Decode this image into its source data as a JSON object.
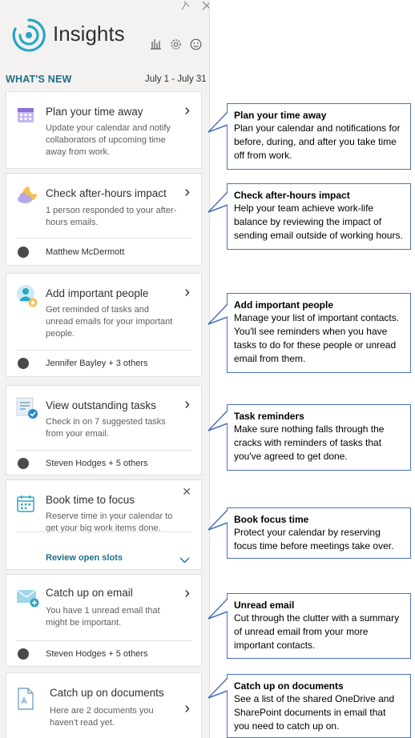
{
  "header": {
    "title": "Insights",
    "whats_new": "WHAT'S NEW",
    "date_range": "July 1 - July 31"
  },
  "cards": [
    {
      "title": "Plan your time away",
      "desc": "Update your calendar and notify collaborators of upcoming time away from work.",
      "icon": "calendar-icon"
    },
    {
      "title": "Check after-hours impact",
      "desc": "1 person responded to your after-hours emails.",
      "people": "Matthew McDermott",
      "icon": "moon-cloud-icon"
    },
    {
      "title": "Add important people",
      "desc": "Get reminded of tasks and unread emails for your important people.",
      "people": "Jennifer Bayley + 3 others",
      "icon": "person-star-icon"
    },
    {
      "title": "View outstanding tasks",
      "desc": "Check in on 7 suggested tasks from your email.",
      "people": "Steven Hodges + 5 others",
      "icon": "task-check-icon"
    },
    {
      "title": "Book time to focus",
      "desc": "Reserve time in your calendar to get your big work items done.",
      "action": "Review open slots",
      "icon": "calendar-focus-icon"
    },
    {
      "title": "Catch up on email",
      "desc": "You have 1 unread email that might be important.",
      "people": "Steven Hodges + 5 others",
      "icon": "envelope-icon"
    },
    {
      "title": "Catch up on documents",
      "desc": "Here are 2 documents you haven't read yet.",
      "icon": "document-icon"
    }
  ],
  "callouts": [
    {
      "title": "Plan your time away",
      "body": "Plan your calendar and notifications for before, during, and after you take time off from work."
    },
    {
      "title": "Check after-hours impact",
      "body": "Help your team achieve work-life balance by reviewing the impact of sending email outside of working hours."
    },
    {
      "title": "Add important people",
      "body": "Manage your list of important contacts. You'll see reminders when you have tasks to do for these people or unread email from them."
    },
    {
      "title": "Task reminders",
      "body": "Make sure nothing falls through the cracks with reminders of tasks that you've agreed to get done."
    },
    {
      "title": "Book focus time",
      "body": "Protect your calendar by reserving focus time before meetings take over."
    },
    {
      "title": "Unread email",
      "body": "Cut through the clutter with a summary of unread email from your more important contacts."
    },
    {
      "title": "Catch up on documents",
      "body": "See a list of the shared OneDrive and SharePoint documents in email that you need to catch up on."
    }
  ],
  "colors": {
    "accent": "#1e6f8a",
    "callout_border": "#4a72b8",
    "pane_bg": "#f3f2f1"
  }
}
